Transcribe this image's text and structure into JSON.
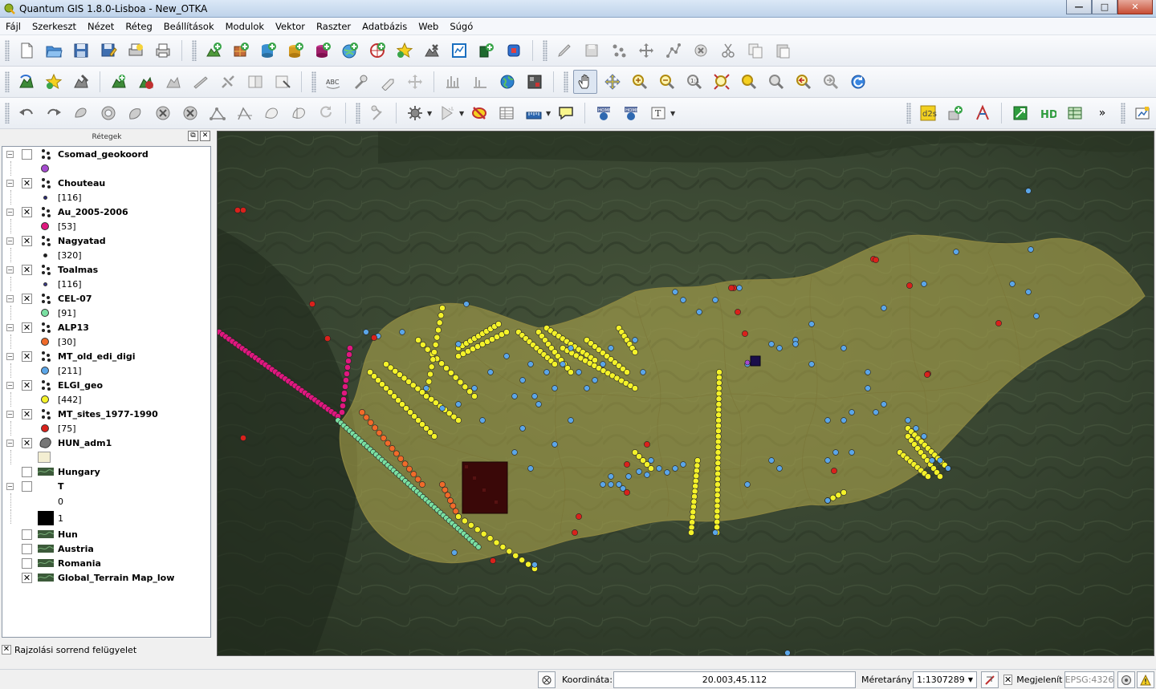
{
  "window": {
    "title": "Quantum GIS 1.8.0-Lisboa - New_OTKA",
    "app_icon": "qgis-logo-icon",
    "buttons": {
      "minimize": "—",
      "maximize": "□",
      "close": "✕"
    }
  },
  "menu": [
    "Fájl",
    "Szerkeszt",
    "Nézet",
    "Réteg",
    "Beállítások",
    "Modulok",
    "Vektor",
    "Raszter",
    "Adatbázis",
    "Web",
    "Súgó"
  ],
  "toolbars": {
    "file": [
      "new-project-icon",
      "open-project-icon",
      "save-project-icon",
      "save-as-icon",
      "new-print-composer-icon",
      "print-icon"
    ],
    "layers_add": [
      "add-vector-layer-icon",
      "add-raster-layer-icon",
      "add-postgis-layer-icon",
      "add-spatialite-layer-icon",
      "add-mssql-layer-icon",
      "add-wms-layer-icon",
      "add-wcs-layer-icon",
      "add-delimited-text-icon",
      "remove-layer-icon",
      "new-shapefile-icon",
      "add-gps-icon",
      "add-oracle-icon"
    ],
    "editing": [
      "toggle-editing-icon",
      "save-edits-icon",
      "add-feature-icon",
      "move-feature-icon",
      "node-tool-icon",
      "delete-selected-icon",
      "cut-features-icon",
      "copy-features-icon",
      "paste-features-icon"
    ],
    "digitize": [
      "plugin-icon-1",
      "plugin-icon-2",
      "plugin-icon-3",
      "plugin-icon-4",
      "plugin-icon-5",
      "plugin-icon-6",
      "plugin-icon-7",
      "plugin-icon-8",
      "plugin-icon-9",
      "plugin-icon-10"
    ],
    "labels": [
      "label-abc-icon",
      "label-pin-icon",
      "label-show-hide-icon",
      "label-move-icon",
      "label-rotate-icon",
      "label-change-icon",
      "globe-icon",
      "raster-calc-icon"
    ],
    "nav": [
      "pan-icon",
      "pan-to-selection-icon",
      "zoom-in-icon",
      "zoom-out-icon",
      "zoom-actual-size-icon",
      "zoom-full-icon",
      "zoom-to-selection-icon",
      "zoom-to-layer-icon",
      "zoom-last-icon",
      "zoom-next-icon",
      "refresh-icon"
    ],
    "advanced": [
      "undo-icon",
      "redo-icon",
      "simplify-icon",
      "add-ring-icon",
      "add-part-icon",
      "delete-ring-icon",
      "delete-part-icon",
      "reshape-icon",
      "offset-curve-icon",
      "split-features-icon",
      "merge-features-icon",
      "merge-attributes-icon",
      "rotate-point-symbols-icon"
    ],
    "attributes": [
      "identify-icon",
      "run-action-icon",
      "select-icon",
      "deselect-icon",
      "attribute-table-icon",
      "measure-icon",
      "map-tips-icon",
      "new-bookmark-icon",
      "show-bookmarks-icon",
      "text-annotation-icon"
    ],
    "plugins": [
      "d2s-icon",
      "add-plugin-icon",
      "vector-tool-icon",
      "export-icon",
      "hd-icon",
      "table-icon"
    ],
    "more_label": "»"
  },
  "layers_panel": {
    "title": "Rétegek",
    "layers": [
      {
        "name": "Csomad_geokoord",
        "checked": false,
        "count": "",
        "color": "#a64bd0",
        "icon": "point-layer-icon"
      },
      {
        "name": "Chouteau",
        "checked": true,
        "count": "[116]",
        "color": "#2a2a7a",
        "icon": "point-layer-icon"
      },
      {
        "name": "Au_2005-2006",
        "checked": true,
        "count": "[53]",
        "color": "#e0187f",
        "icon": "point-layer-icon"
      },
      {
        "name": "Nagyatad",
        "checked": true,
        "count": "[320]",
        "color": "#1a1a1a",
        "icon": "point-layer-icon"
      },
      {
        "name": "Toalmas",
        "checked": true,
        "count": "[116]",
        "color": "#3a3a8a",
        "icon": "point-layer-icon"
      },
      {
        "name": "CEL-07",
        "checked": true,
        "count": "[91]",
        "color": "#7ae0a2",
        "icon": "point-layer-icon"
      },
      {
        "name": "ALP13",
        "checked": true,
        "count": "[30]",
        "color": "#f06b2a",
        "icon": "point-layer-icon"
      },
      {
        "name": "MT_old_edi_digi",
        "checked": true,
        "count": "[211]",
        "color": "#5ba6e8",
        "icon": "point-layer-icon"
      },
      {
        "name": "ELGI_geo",
        "checked": true,
        "count": "[442]",
        "color": "#f4f22a",
        "icon": "point-layer-icon"
      },
      {
        "name": "MT_sites_1977-1990",
        "checked": true,
        "count": "[75]",
        "color": "#d9211b",
        "icon": "point-layer-icon"
      },
      {
        "name": "HUN_adm1",
        "checked": true,
        "count": "",
        "color": "#f3eed2",
        "icon": "polygon-layer-icon"
      }
    ],
    "rasters": [
      {
        "name": "Hungary",
        "checked": false
      },
      {
        "name": "T",
        "checked": false,
        "legend": [
          "0",
          "1"
        ]
      },
      {
        "name": "Hun",
        "checked": false
      },
      {
        "name": "Austria",
        "checked": false
      },
      {
        "name": "Romania",
        "checked": false
      },
      {
        "name": "Global_Terrain Map_low",
        "checked": true
      }
    ],
    "draw_order_label": "Rajzolási sorrend felügyelet"
  },
  "statusbar": {
    "coordinate_label": "Koordináta:",
    "coordinate_value": "20.003,45.112",
    "scale_label": "Méretarány",
    "scale_value": "1:1307289",
    "render_label": "Megjelenít",
    "crs": "EPSG:4326"
  }
}
